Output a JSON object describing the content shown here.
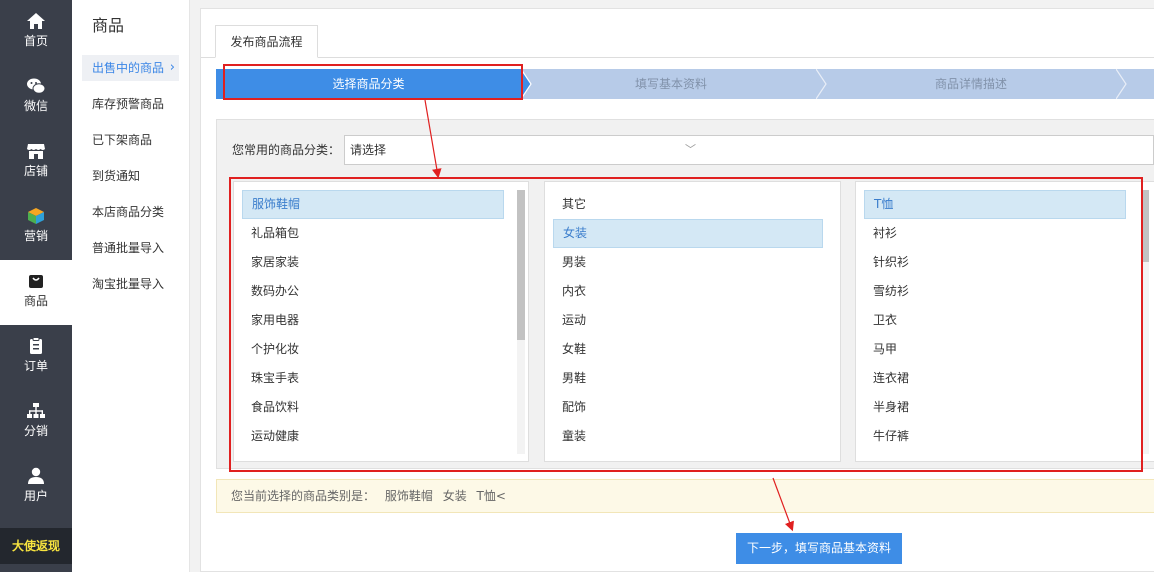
{
  "rail": {
    "items": [
      {
        "label": "首页",
        "icon": "home-icon"
      },
      {
        "label": "微信",
        "icon": "wechat-icon"
      },
      {
        "label": "店铺",
        "icon": "store-icon"
      },
      {
        "label": "营销",
        "icon": "marketing-cube-icon"
      },
      {
        "label": "商品",
        "icon": "product-bag-icon"
      },
      {
        "label": "订单",
        "icon": "order-clipboard-icon"
      },
      {
        "label": "分销",
        "icon": "distribution-tree-icon"
      },
      {
        "label": "用户",
        "icon": "user-icon"
      }
    ],
    "active_index": 4,
    "promo_label": "大使返现",
    "promo_color": "#f7e33f"
  },
  "submenu": {
    "title": "商品",
    "items": [
      "出售中的商品",
      "库存预警商品",
      "已下架商品",
      "到货通知",
      "本店商品分类",
      "普通批量导入",
      "淘宝批量导入"
    ],
    "active_index": 0
  },
  "tab": {
    "label": "发布商品流程"
  },
  "steps": [
    {
      "label": "选择商品分类",
      "active": true
    },
    {
      "label": "填写基本资料",
      "active": false
    },
    {
      "label": "商品详情描述",
      "active": false
    }
  ],
  "common": {
    "label": "您常用的商品分类：",
    "select_value": "请选择"
  },
  "columns": [
    {
      "items": [
        "服饰鞋帽",
        "礼品箱包",
        "家居家装",
        "数码办公",
        "家用电器",
        "个护化妆",
        "珠宝手表",
        "食品饮料",
        "运动健康"
      ],
      "selected": 0
    },
    {
      "items": [
        "其它",
        "女装",
        "男装",
        "内衣",
        "运动",
        "女鞋",
        "男鞋",
        "配饰",
        "童装"
      ],
      "selected": 1
    },
    {
      "items": [
        "T恤",
        "衬衫",
        "针织衫",
        "雪纺衫",
        "卫衣",
        "马甲",
        "连衣裙",
        "半身裙",
        "牛仔裤"
      ],
      "selected": 0
    }
  ],
  "current": {
    "prefix": "您当前选择的商品类别是：",
    "path": [
      "服饰鞋帽",
      "女装",
      "T恤<"
    ]
  },
  "next_button": "下一步，填写商品基本资料",
  "colors": {
    "accent": "#3e8de6",
    "step_inactive": "#b7cbe8",
    "annotation": "#e02020",
    "rail": "#3a3f4a"
  }
}
